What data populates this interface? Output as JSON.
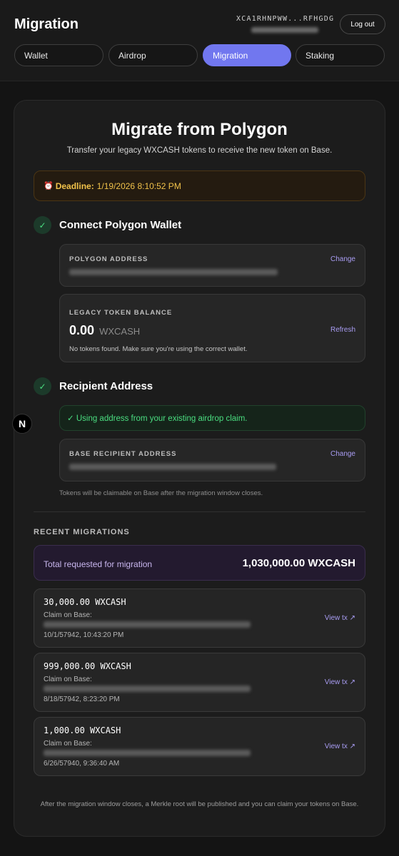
{
  "header": {
    "title": "Migration",
    "wallet_address": "XCA1RHNPWW...RFHGDG",
    "logout_label": "Log out"
  },
  "tabs": [
    {
      "label": "Wallet",
      "active": false
    },
    {
      "label": "Airdrop",
      "active": false
    },
    {
      "label": "Migration",
      "active": true
    },
    {
      "label": "Staking",
      "active": false
    }
  ],
  "migrate": {
    "title": "Migrate from Polygon",
    "subtitle": "Transfer your legacy WXCASH tokens to receive the new token on Base.",
    "deadline_label": "Deadline:",
    "deadline_value": "1/19/2026 8:10:52 PM"
  },
  "step1": {
    "title": "Connect Polygon Wallet",
    "polygon_address_label": "POLYGON ADDRESS",
    "change_label": "Change",
    "balance_label": "LEGACY TOKEN BALANCE",
    "balance_value": "0.00",
    "balance_unit": "WXCASH",
    "refresh_label": "Refresh",
    "balance_note": "No tokens found. Make sure you're using the correct wallet."
  },
  "step2": {
    "title": "Recipient Address",
    "info": "✓ Using address from your existing airdrop claim.",
    "base_address_label": "BASE RECIPIENT ADDRESS",
    "change_label": "Change",
    "note": "Tokens will be claimable on Base after the migration window closes."
  },
  "recent": {
    "heading": "RECENT MIGRATIONS",
    "total_label": "Total requested for migration",
    "total_value": "1,030,000.00 WXCASH",
    "items": [
      {
        "amount": "30,000.00 WXCASH",
        "claim_label": "Claim on Base:",
        "date": "10/1/57942, 10:43:20 PM",
        "view_label": "View tx ↗"
      },
      {
        "amount": "999,000.00 WXCASH",
        "claim_label": "Claim on Base:",
        "date": "8/18/57942, 8:23:20 PM",
        "view_label": "View tx ↗"
      },
      {
        "amount": "1,000.00 WXCASH",
        "claim_label": "Claim on Base:",
        "date": "6/26/57940, 9:36:40 AM",
        "view_label": "View tx ↗"
      }
    ]
  },
  "footer_note": "After the migration window closes, a Merkle root will be published and you can claim your tokens on Base.",
  "badge_letter": "N",
  "colors": {
    "accent": "#7177ef",
    "link": "#a89cf2",
    "success": "#4ade80",
    "warning": "#f1c24a"
  }
}
